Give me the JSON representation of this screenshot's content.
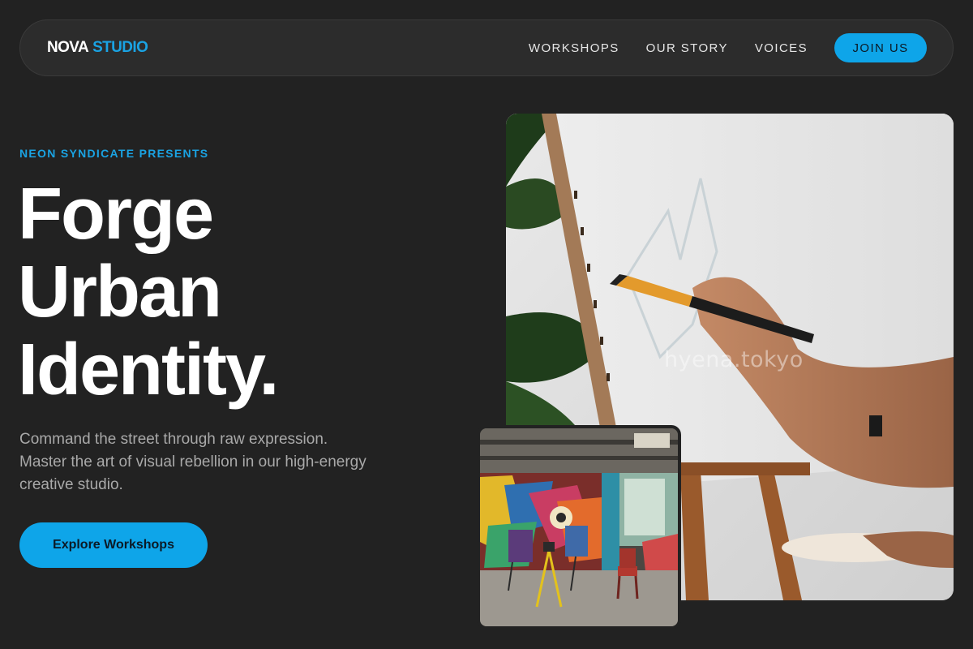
{
  "nav": {
    "logo_primary": "NOVA",
    "logo_accent": "STUDIO",
    "links": [
      "WORKSHOPS",
      "OUR STORY",
      "VOICES"
    ],
    "cta_label": "JOIN US"
  },
  "hero": {
    "eyebrow": "NEON SYNDICATE PRESENTS",
    "headline_lines": [
      "Forge",
      "Urban",
      "Identity."
    ],
    "subtitle": "Command the street through raw expression. Master the art of visual rebellion in our high-energy creative studio.",
    "cta_label": "Explore Workshops"
  },
  "images": {
    "main_watermark": "hyena.tokyo",
    "main_icon": "painter-at-easel-photo",
    "inset_icon": "graffiti-studio-photo"
  },
  "colors": {
    "background": "#222222",
    "nav_background": "#2c2c2c",
    "accent": "#0ea5e9",
    "text": "#ffffff",
    "muted_text": "#a9a9a9"
  }
}
